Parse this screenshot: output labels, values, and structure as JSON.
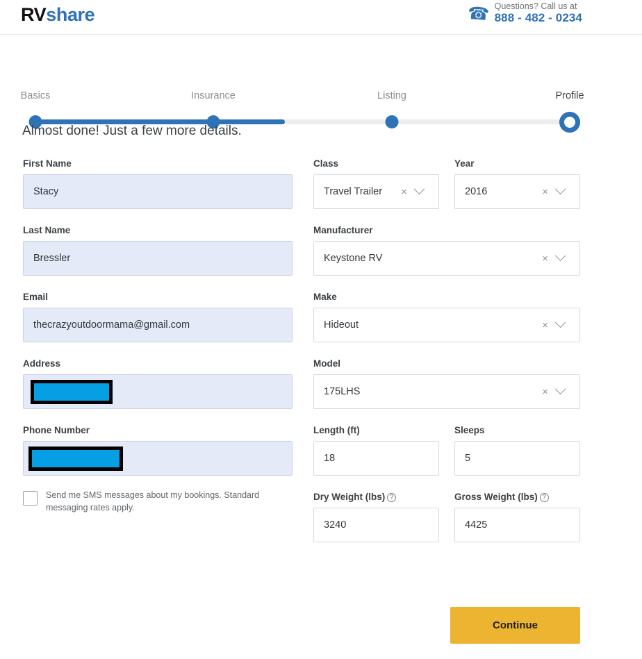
{
  "header": {
    "logo_rv": "RV",
    "logo_share": "share",
    "phone_icon": "phone-icon",
    "questions_label": "Questions? Call us at",
    "phone_number": "888 - 482 - 0234",
    "brand_blue": "#2e72b8"
  },
  "stepper": {
    "steps": [
      {
        "label": "Basics",
        "state": "complete"
      },
      {
        "label": "Insurance",
        "state": "complete"
      },
      {
        "label": "Listing",
        "state": "upcoming"
      },
      {
        "label": "Profile",
        "state": "current"
      }
    ],
    "progress_percent": 47,
    "fill_color": "#2e72b8",
    "track_color": "#ededed"
  },
  "main": {
    "headline": "Almost done! Just a few more details.",
    "left_fields": {
      "first_name": {
        "label": "First Name",
        "value": "Stacy"
      },
      "last_name": {
        "label": "Last Name",
        "value": "Bressler"
      },
      "email": {
        "label": "Email",
        "value": "thecrazyoutdoormama@gmail.com"
      },
      "address": {
        "label": "Address",
        "value": "",
        "redacted": true
      },
      "phone_number": {
        "label": "Phone Number",
        "value": "",
        "redacted": true
      }
    },
    "sms_checkbox": {
      "checked": false,
      "text": "Send me SMS messages about my bookings. Standard messaging rates apply."
    },
    "right_fields": {
      "class": {
        "label": "Class",
        "value": "Travel Trailer",
        "type": "select"
      },
      "year": {
        "label": "Year",
        "value": "2016",
        "type": "select"
      },
      "manufacturer": {
        "label": "Manufacturer",
        "value": "Keystone RV",
        "type": "select"
      },
      "make": {
        "label": "Make",
        "value": "Hideout",
        "type": "select"
      },
      "model": {
        "label": "Model",
        "value": "175LHS",
        "type": "select"
      },
      "length": {
        "label": "Length (ft)",
        "value": "18",
        "type": "text"
      },
      "sleeps": {
        "label": "Sleeps",
        "value": "5",
        "type": "text"
      },
      "dry_weight": {
        "label": "Dry Weight (lbs)",
        "value": "3240",
        "type": "text",
        "has_help": true
      },
      "gross_weight": {
        "label": "Gross Weight (lbs)",
        "value": "4425",
        "type": "text",
        "has_help": true
      }
    },
    "select_clear_glyph": "×",
    "continue_label": "Continue",
    "continue_color": "#edb431"
  }
}
